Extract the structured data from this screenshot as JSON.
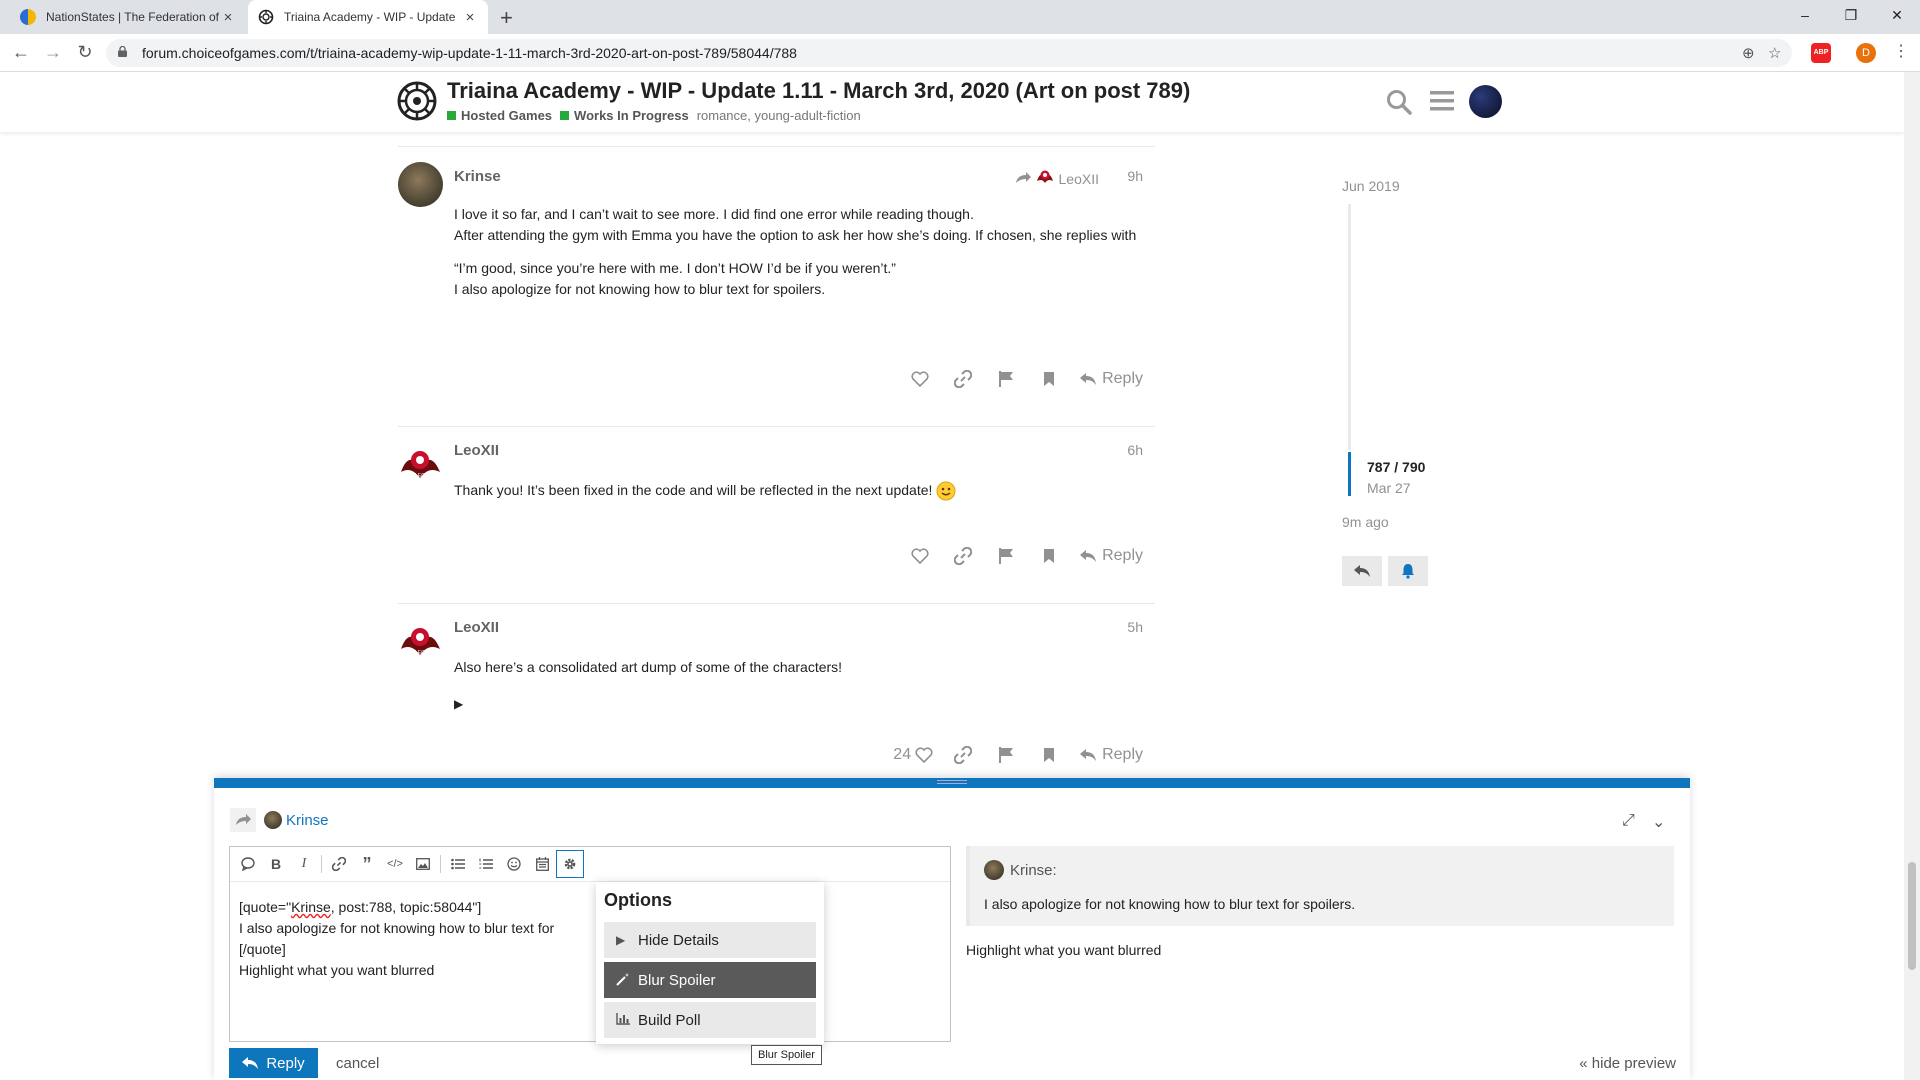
{
  "browser": {
    "tabs": [
      {
        "title": "NationStates | The Federation of",
        "close": "×"
      },
      {
        "title": "Triaina Academy - WIP - Update",
        "close": "×"
      }
    ],
    "new_tab": "+",
    "url": "forum.choiceofgames.com/t/triaina-academy-wip-update-1-11-march-3rd-2020-art-on-post-789/58044/788",
    "profile_initial": "D",
    "abp_label": "ABP",
    "window_controls": [
      "–",
      "❐",
      "✕"
    ]
  },
  "header": {
    "title": "Triaina Academy - WIP - Update 1.11 - March 3rd, 2020 (Art on post 789)",
    "categories": [
      "Hosted Games",
      "Works In Progress"
    ],
    "category_color": "#25aa3b",
    "tags": "romance, young-adult-fiction"
  },
  "posts": [
    {
      "username": "Krinse",
      "reply_to": "LeoXII",
      "time": "9h",
      "paragraphs": [
        "I love it so far, and I can’t wait to see more. I did find one error while reading though.\nAfter attending the gym with Emma you have the option to ask her how she’s doing. If chosen, she replies with",
        "“I’m good, since you’re here with me. I don’t HOW I’d be if you weren’t.”\nI also apologize for not knowing how to blur text for spoilers."
      ],
      "reply_label": "Reply"
    },
    {
      "username": "LeoXII",
      "time": "6h",
      "paragraphs": [
        "Thank you! It’s been fixed in the code and will be reflected in the next update!"
      ],
      "reply_label": "Reply"
    },
    {
      "username": "LeoXII",
      "time": "5h",
      "paragraphs": [
        "Also here’s a consolidated art dump of some of the characters!"
      ],
      "details_toggle": "▶",
      "like_count": "24",
      "reply_label": "Reply"
    }
  ],
  "timeline": {
    "start_date": "Jun 2019",
    "position": "787 / 790",
    "position_date": "Mar 27",
    "end": "9m ago"
  },
  "composer": {
    "replying_to": "Krinse",
    "editor_lines": {
      "l1_prefix": "[quote=\"",
      "l1_name": "Krinse",
      "l1_suffix": ", post:788, topic:58044\"]",
      "l2": "I also apologize for not knowing how to blur text for",
      "l3": "[/quote]",
      "l4": "Highlight what you want blurred"
    },
    "options_menu": {
      "title": "Options",
      "items": [
        "Hide Details",
        "Blur Spoiler",
        "Build Poll"
      ],
      "highlighted": "Blur Spoiler"
    },
    "tooltip": "Blur Spoiler",
    "preview": {
      "quote_user": "Krinse:",
      "quote_text": "I also apologize for not knowing how to blur text for spoilers.",
      "text": "Highlight what you want blurred"
    },
    "reply_button": "Reply",
    "cancel": "cancel",
    "hide_preview": "« hide preview"
  },
  "colors": {
    "accent": "#0e76bd",
    "muted": "#919191"
  }
}
